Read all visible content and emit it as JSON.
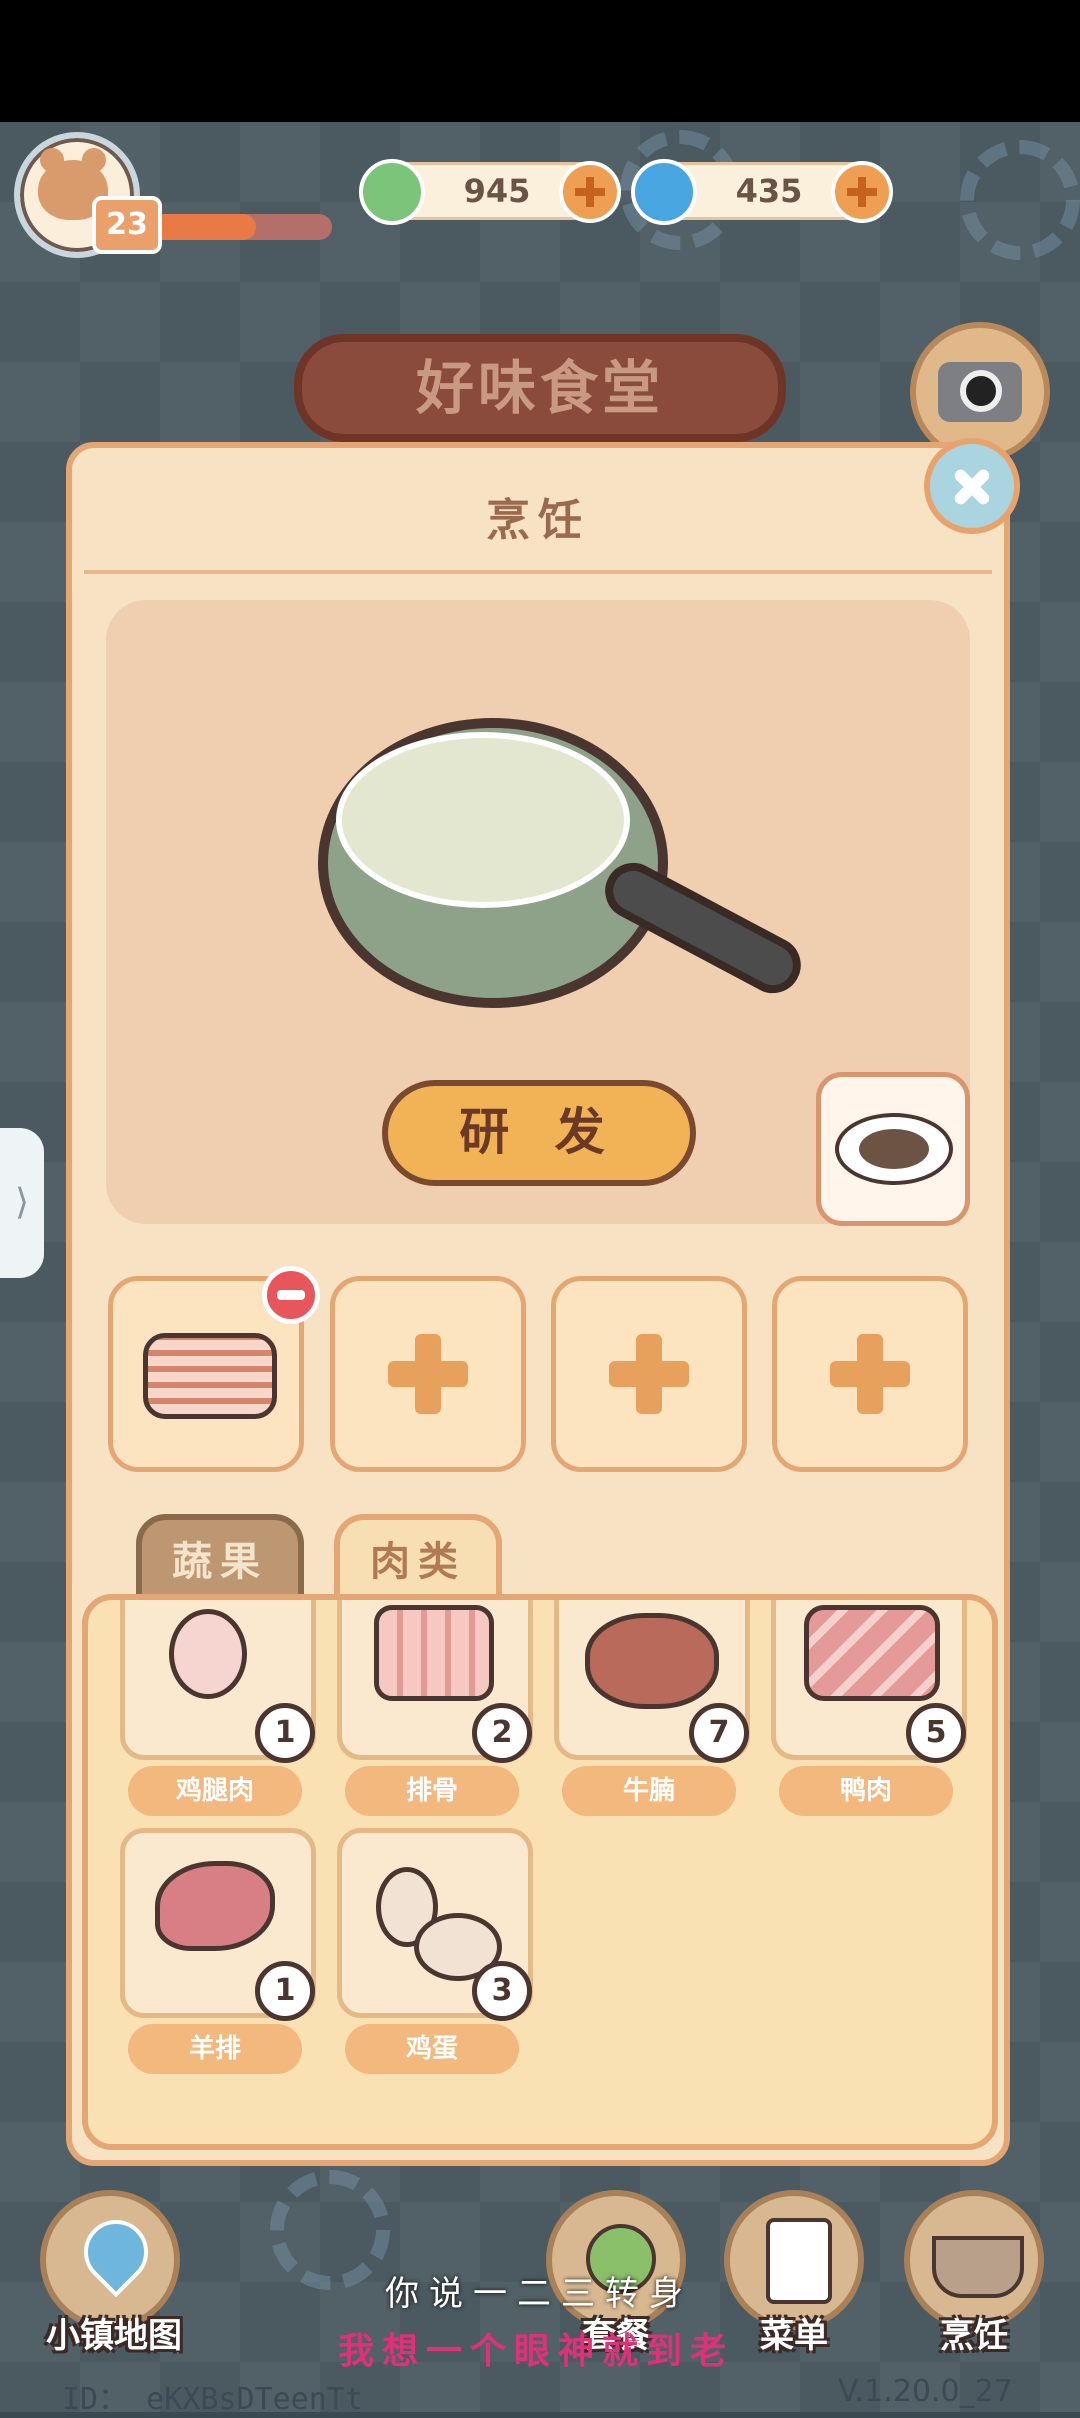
{
  "player": {
    "level": "23",
    "xp_progress": 0.6
  },
  "resources": [
    {
      "name": "clover",
      "icon": "clover-coin-icon",
      "value": "945",
      "color": "#7cc47a"
    },
    {
      "name": "swirl",
      "icon": "swirl-gem-icon",
      "value": "435",
      "color": "#4aa6e0"
    }
  ],
  "restaurant_sign": "好味食堂",
  "panel": {
    "title": "烹饪",
    "develop_label": "研 发"
  },
  "tabs": [
    {
      "label": "蔬果",
      "active": false
    },
    {
      "label": "肉类",
      "active": true
    }
  ],
  "inventory": [
    {
      "name": "鸡腿肉",
      "count": "1",
      "icon": "chicken-leg-icon"
    },
    {
      "name": "排骨",
      "count": "2",
      "icon": "ribs-icon"
    },
    {
      "name": "牛腩",
      "count": "7",
      "icon": "steak-icon"
    },
    {
      "name": "鸭肉",
      "count": "5",
      "icon": "duck-meat-icon"
    },
    {
      "name": "羊排",
      "count": "1",
      "icon": "lamb-chop-icon"
    },
    {
      "name": "鸡蛋",
      "count": "3",
      "icon": "eggs-icon"
    }
  ],
  "nav": [
    {
      "label": "小镇地图",
      "icon": "map-pin-icon"
    },
    {
      "label": "套餐",
      "icon": "skewer-icon"
    },
    {
      "label": "菜单",
      "icon": "clipboard-icon"
    },
    {
      "label": "烹饪",
      "icon": "cooking-pot-icon"
    }
  ],
  "footer": {
    "user_id": "ID： eKXBsDTeenTt",
    "version": "V.1.20.0_27"
  },
  "subtitles": {
    "line1": "你说一二三转身",
    "line2": "我想一个眼神就到老"
  }
}
